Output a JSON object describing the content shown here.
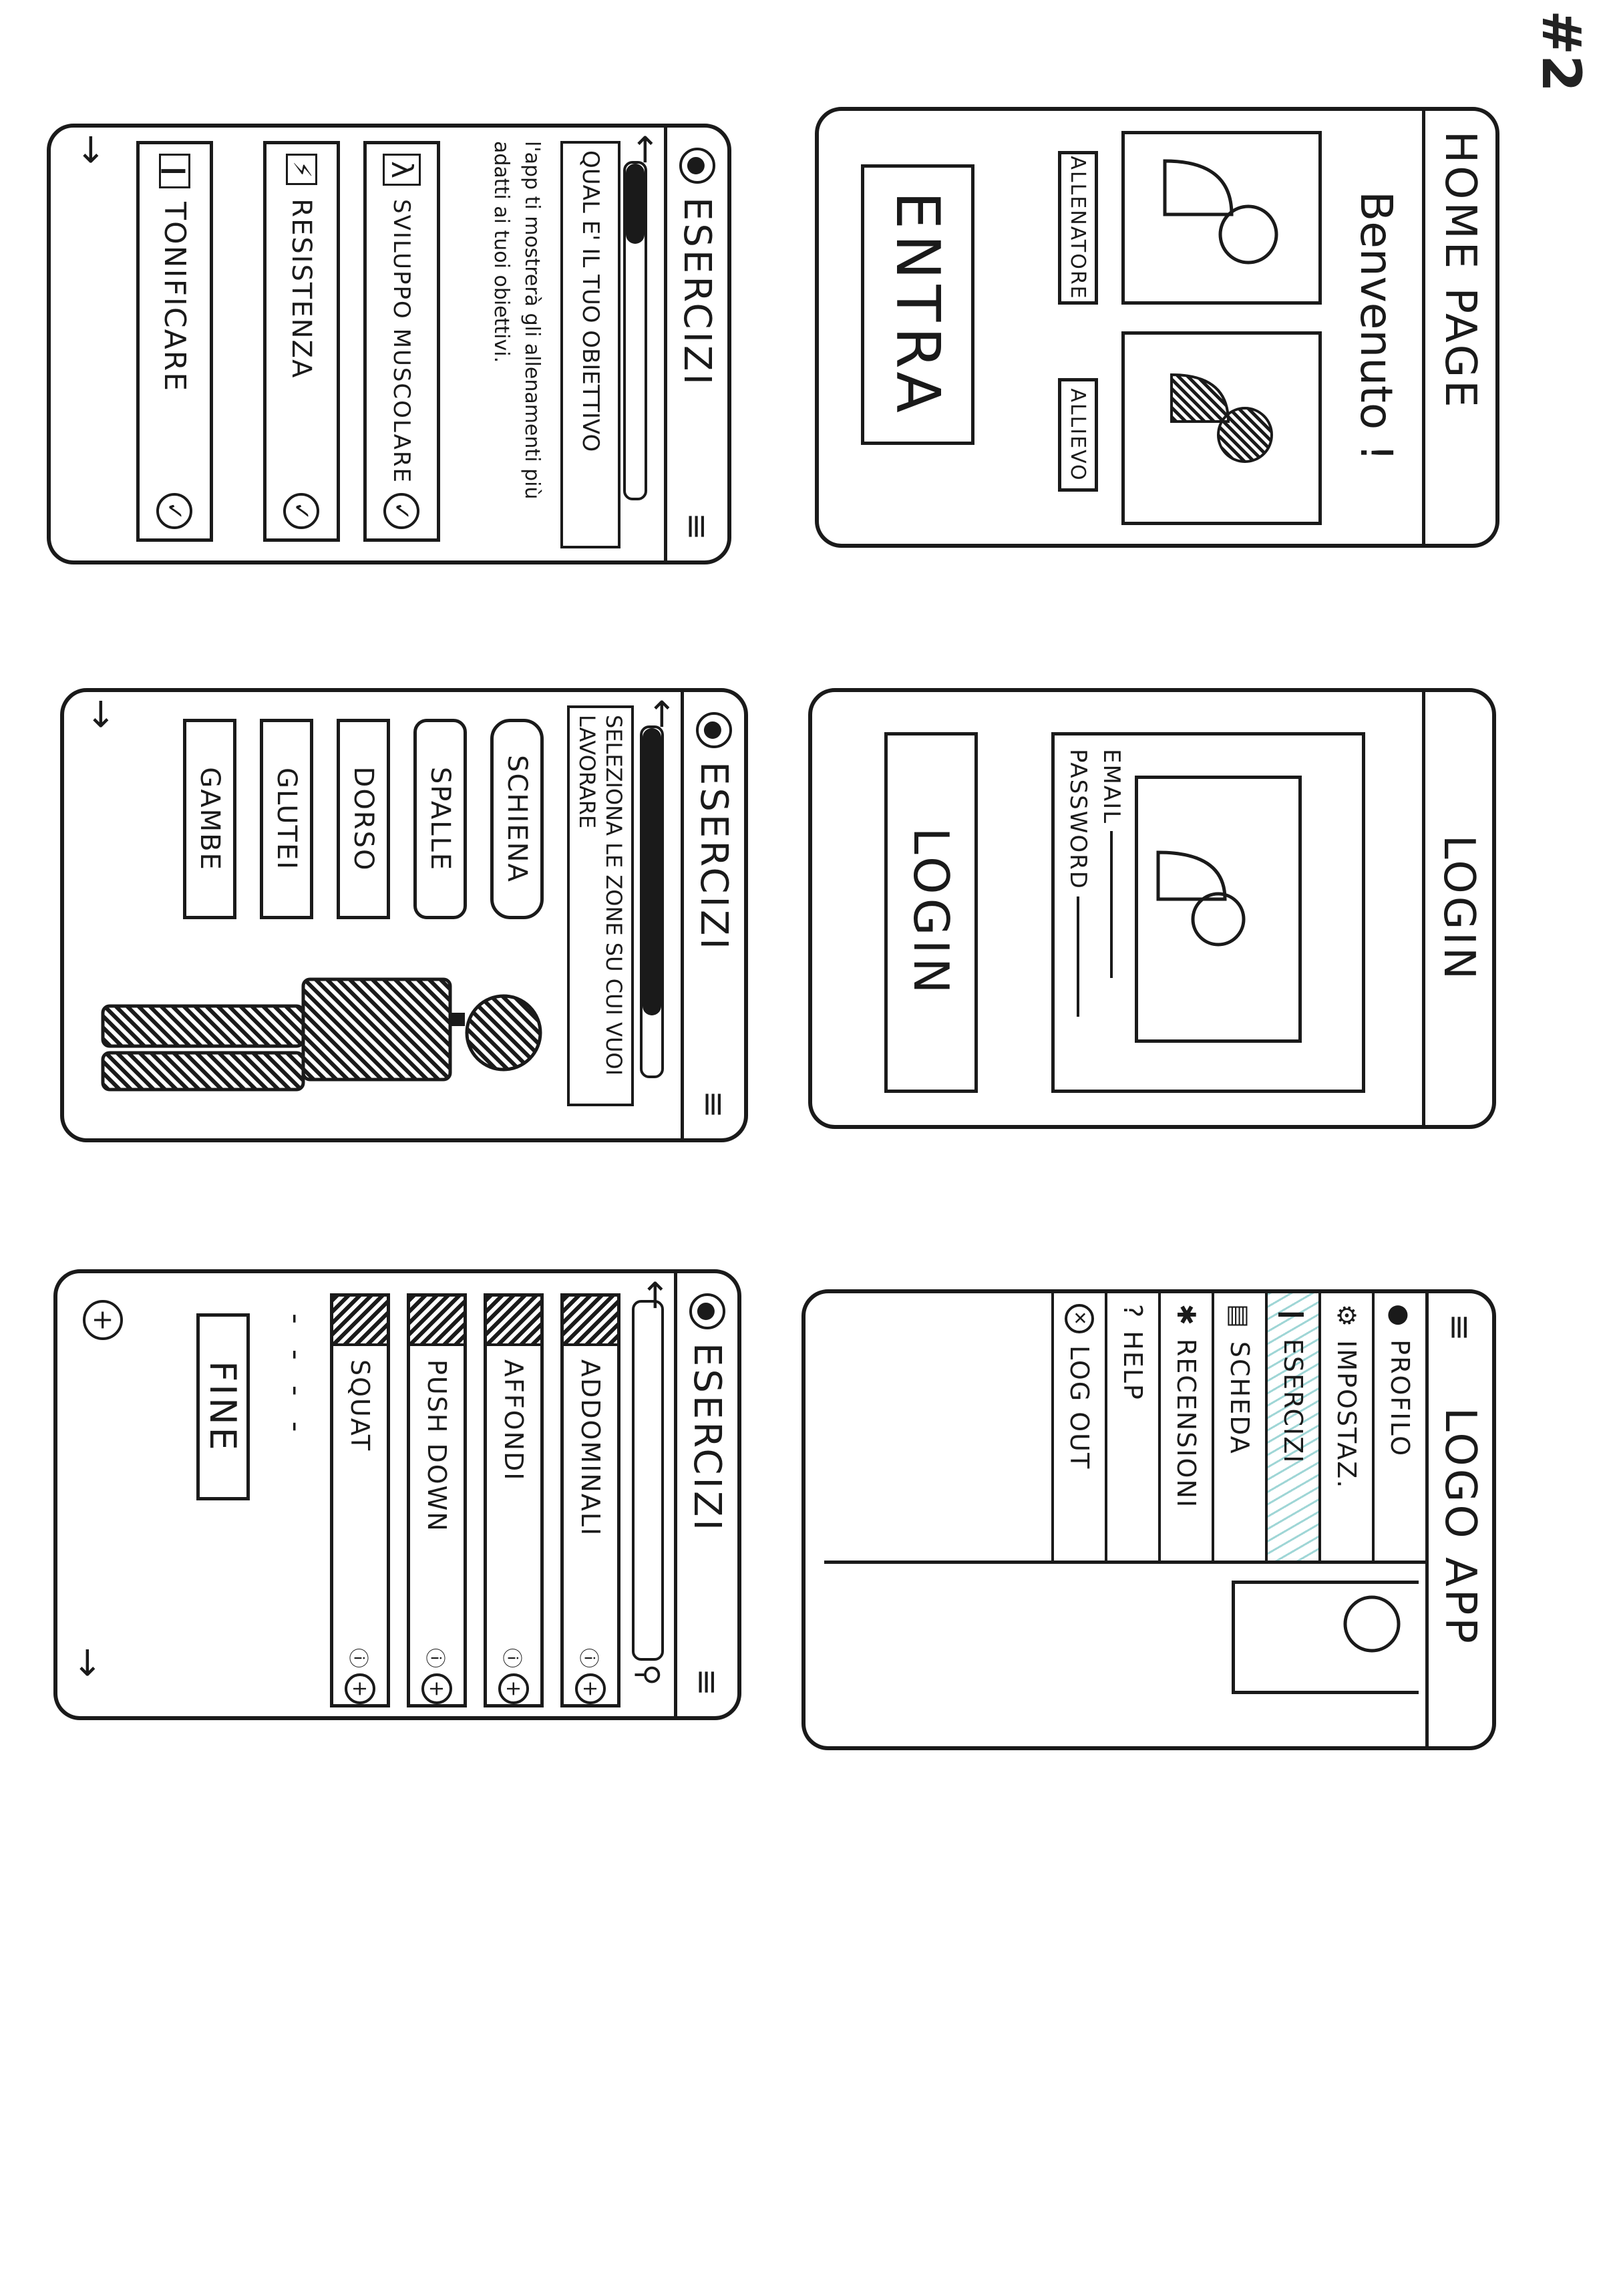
{
  "page_number": "#2",
  "screens": {
    "home": {
      "title": "HOME PAGE",
      "welcome": "Benvenuto !",
      "coach_label": "ALLENATORE",
      "student_label": "ALLIEVO",
      "enter_button": "ENTRA"
    },
    "login": {
      "title": "LOGIN",
      "email_label": "EMAIL",
      "password_label": "PASSWORD",
      "login_button": "LOGIN"
    },
    "menu": {
      "title": "LOGO APP",
      "items": [
        "PROFILO",
        "IMPOSTAZ.",
        "ESERCIZI",
        "SCHEDA",
        "RECENSIONI",
        "HELP",
        "LOG OUT"
      ]
    },
    "goals": {
      "title": "ESERCIZI",
      "question": "QUAL E' IL TUO OBIETTIVO",
      "description": "l'app ti mostrerà gli allenamenti più adatti ai tuoi obiettivi.",
      "options": [
        "SVILUPPO MUSCOLARE",
        "RESISTENZA",
        "TONIFICARE"
      ]
    },
    "zones": {
      "title": "ESERCIZI",
      "instruction": "SELEZIONA LE ZONE SU CUI VUOI LAVORARE",
      "zones": [
        "SCHIENA",
        "SPALLE",
        "DORSO",
        "GLUTEI",
        "GAMBE"
      ]
    },
    "exercises": {
      "title": "ESERCIZI",
      "items": [
        "ADDOMINALI",
        "AFFONDI",
        "PUSH DOWN",
        "SQUAT"
      ],
      "more": "- - - -",
      "finish_button": "FINE"
    }
  }
}
